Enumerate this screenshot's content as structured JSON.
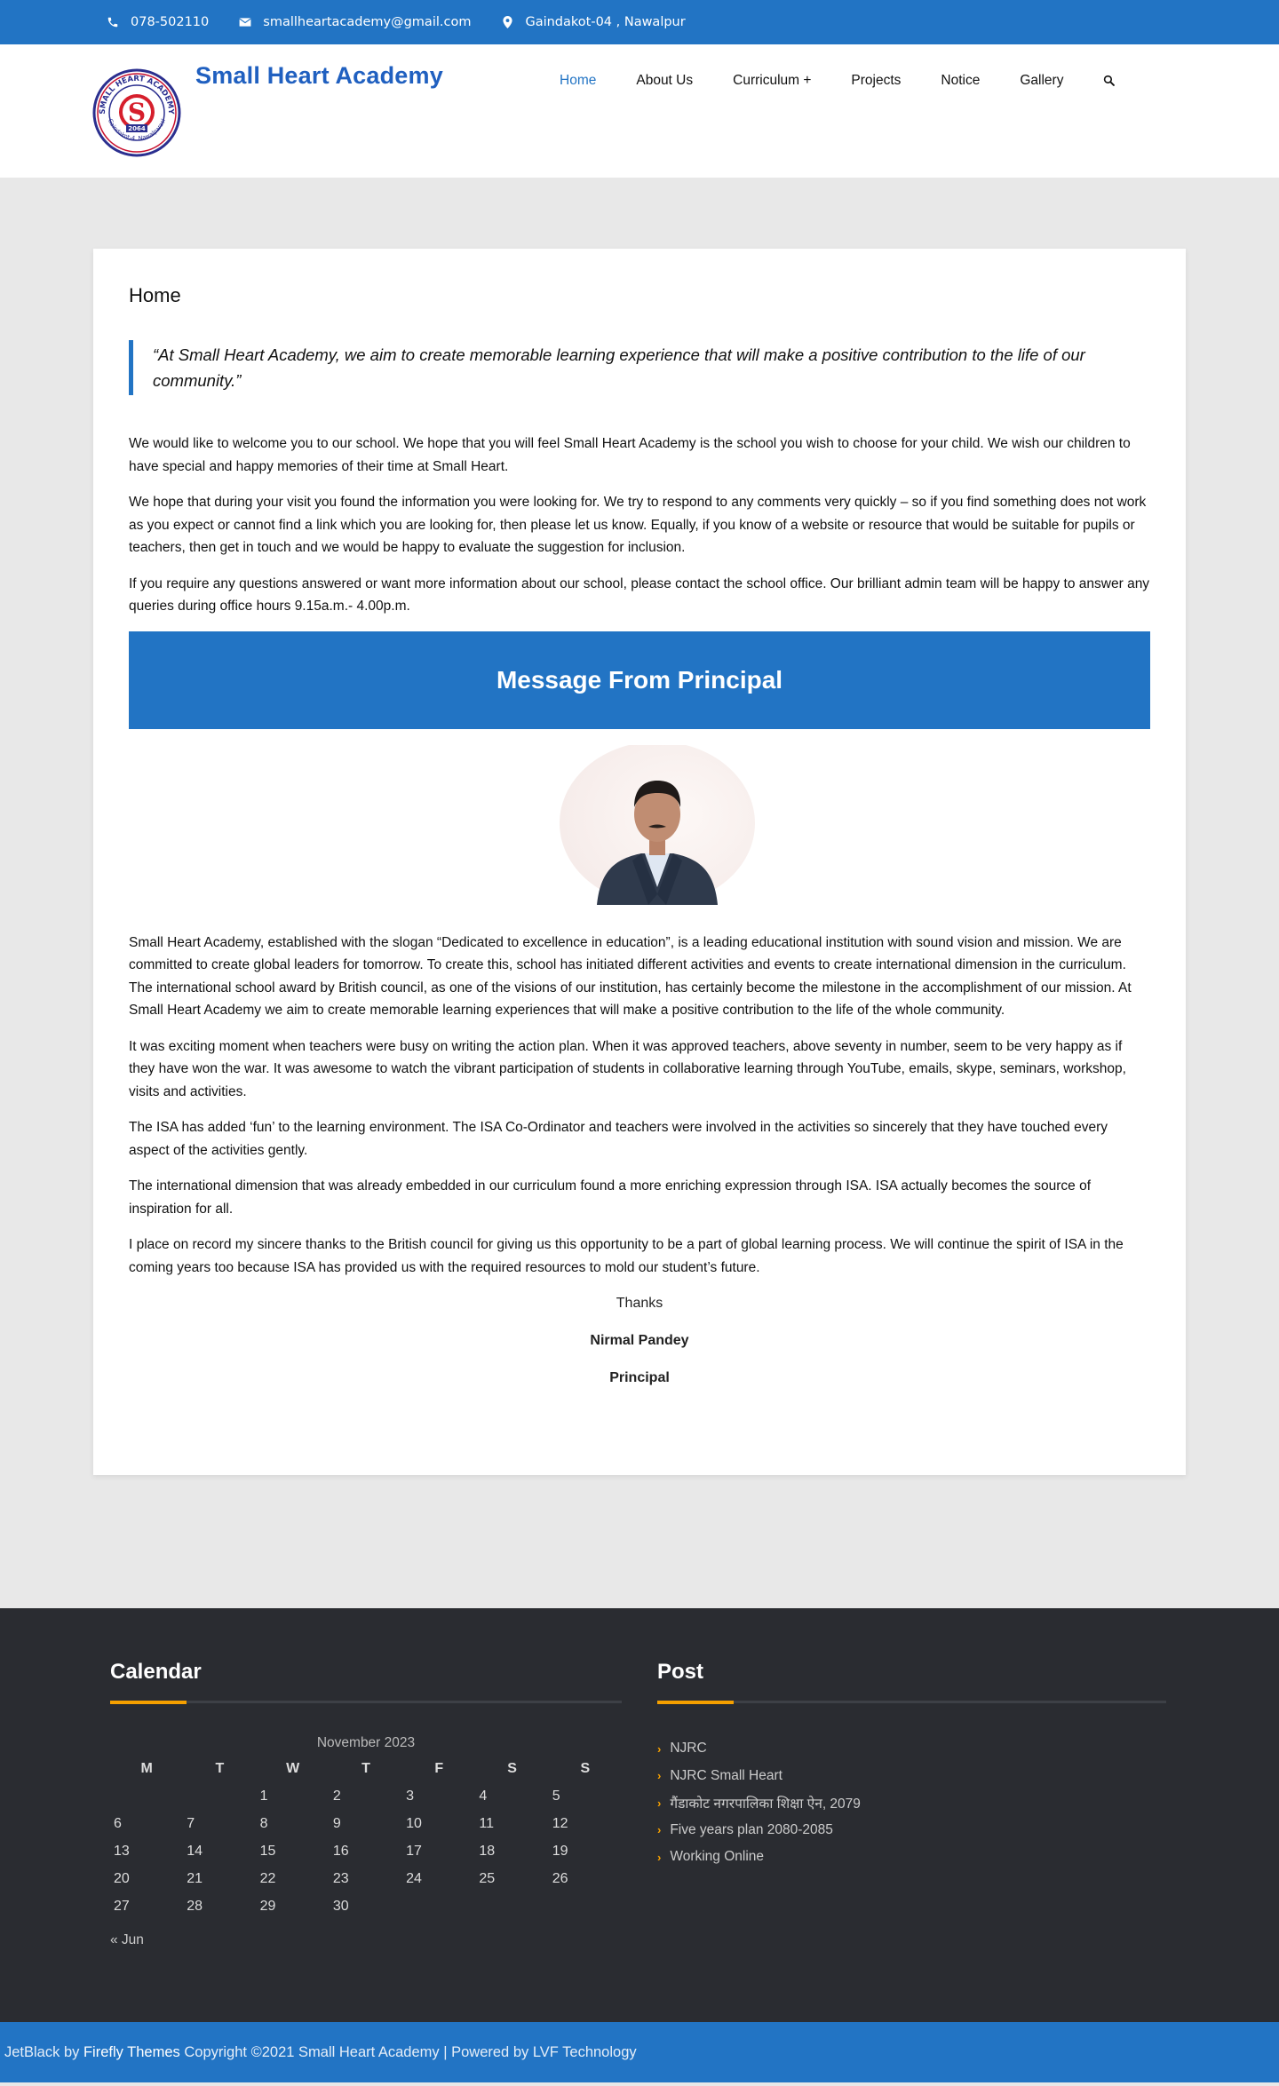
{
  "topbar": {
    "phone": "078-502110",
    "email": "smallheartacademy@gmail.com",
    "address": "Gaindakot-04 , Nawalpur"
  },
  "header": {
    "site_title": "Small Heart Academy",
    "logo": {
      "top_text": "SMALL HEART ACADEMY",
      "year": "2064",
      "bottom_text": "Gaindakot-4, Nawalparasi"
    },
    "nav": [
      "Home",
      "About Us",
      "Curriculum +",
      "Projects",
      "Notice",
      "Gallery"
    ]
  },
  "content": {
    "page_title": "Home",
    "quote": "“At Small Heart Academy, we aim to create memorable learning experience that will make a positive contribution to the life of our community.”",
    "intro": [
      "We would like to welcome you to our school. We hope that you will feel Small Heart Academy is the school you wish to choose for your child. We wish our children to have special and happy memories of their time at Small Heart.",
      "We hope that during your visit you found the information you were looking for. We try to respond to any comments very quickly – so if you find something does not work as you expect or cannot find a link which you are looking for, then please let us know. Equally, if you know of a website or resource that would be suitable for pupils or teachers, then get in touch and we would be happy to evaluate the suggestion for inclusion.",
      "If you require any questions answered or want more information about our school, please contact the school office. Our brilliant admin team will be happy to answer any queries during office hours 9.15a.m.- 4.00p.m."
    ],
    "message_heading": "Message From Principal",
    "message": [
      "Small Heart Academy, established with the slogan “Dedicated to excellence in education”, is a leading educational institution with sound vision and mission. We are committed to create global leaders for tomorrow. To create this, school has initiated different activities and events to create international dimension in the curriculum. The international school award by British council, as one of the visions of our institution, has certainly become the milestone in the accomplishment of our mission. At Small Heart Academy we aim to create memorable learning experiences that will make a positive contribution to the life of the whole community.",
      "It was exciting moment when teachers were busy on writing the action plan. When it was approved teachers, above seventy in number, seem to be very happy as if they have won the war. It was awesome to watch the vibrant participation of students in collaborative learning through YouTube, emails, skype, seminars, workshop, visits and activities.",
      "The ISA has added ‘fun’ to the learning environment. The ISA Co-Ordinator and teachers were involved in the activities so sincerely that they have touched every aspect of the activities gently.",
      "The international dimension that was already embedded in our curriculum found a more enriching expression through ISA. ISA actually becomes the source of inspiration for all.",
      "I place on record my sincere thanks to the British council for giving us this opportunity to be a part of global learning process. We will continue the spirit of ISA in the coming years too because ISA has provided us with the required resources to mold our student’s future."
    ],
    "thanks": "Thanks",
    "principal_name": "Nirmal Pandey",
    "principal_title": "Principal"
  },
  "footer": {
    "calendar": {
      "title": "Calendar",
      "caption": "November 2023",
      "days": [
        "M",
        "T",
        "W",
        "T",
        "F",
        "S",
        "S"
      ],
      "weeks": [
        [
          "",
          "",
          "1",
          "2",
          "3",
          "4",
          "5"
        ],
        [
          "6",
          "7",
          "8",
          "9",
          "10",
          "11",
          "12"
        ],
        [
          "13",
          "14",
          "15",
          "16",
          "17",
          "18",
          "19"
        ],
        [
          "20",
          "21",
          "22",
          "23",
          "24",
          "25",
          "26"
        ],
        [
          "27",
          "28",
          "29",
          "30",
          "",
          "",
          ""
        ]
      ],
      "prev": "« Jun"
    },
    "post": {
      "title": "Post",
      "items": [
        "NJRC",
        "NJRC Small Heart",
        "गैंडाकोट नगरपालिका शिक्षा ऐन, 2079",
        "Five years plan 2080-2085",
        "Working Online"
      ]
    },
    "credits": {
      "theme": "JetBlack",
      "by": " by ",
      "author": "Firefly Themes",
      "copyright": " Copyright ©2021 Small Heart Academy | Powered by LVF Technology"
    }
  },
  "colors": {
    "primary": "#2274c4",
    "accent": "#f5a000",
    "footer_bg": "#2a2c31",
    "title": "#2060c0"
  },
  "icons": {
    "phone": "phone-icon",
    "email": "envelope-icon",
    "address": "map-marker-icon",
    "search": "search-icon",
    "post_bullet": "chevron-right-icon"
  }
}
